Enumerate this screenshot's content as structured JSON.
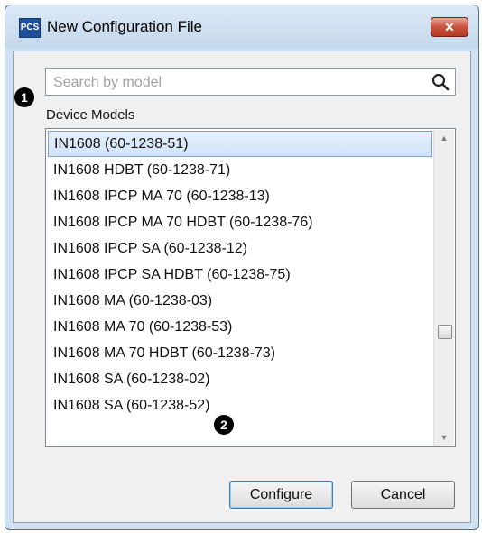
{
  "window": {
    "app_icon_text": "PCS",
    "title": "New Configuration File",
    "close_label": "✕"
  },
  "search": {
    "placeholder": "Search by model",
    "value": "",
    "icon": "search-icon"
  },
  "models": {
    "label": "Device Models",
    "items": [
      "IN1608 (60-1238-51)",
      "IN1608 HDBT (60-1238-71)",
      "IN1608 IPCP MA 70 (60-1238-13)",
      "IN1608 IPCP MA 70 HDBT (60-1238-76)",
      "IN1608 IPCP SA (60-1238-12)",
      "IN1608 IPCP SA HDBT (60-1238-75)",
      "IN1608 MA (60-1238-03)",
      "IN1608 MA 70 (60-1238-53)",
      "IN1608 MA 70 HDBT (60-1238-73)",
      "IN1608 SA (60-1238-02)",
      "IN1608 SA (60-1238-52)"
    ],
    "selected_index": 0
  },
  "callouts": {
    "one": "1",
    "two": "2"
  },
  "buttons": {
    "configure": "Configure",
    "cancel": "Cancel"
  },
  "colors": {
    "selection": "#cfe3f8",
    "close_button": "#c7513c",
    "frame": "#cfe0f1"
  }
}
